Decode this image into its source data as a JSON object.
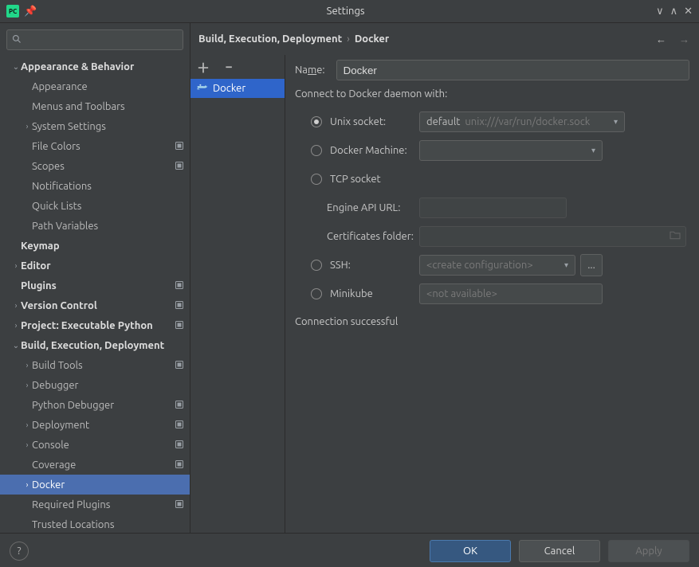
{
  "window_title": "Settings",
  "breadcrumb": {
    "a": "Build, Execution, Deployment",
    "b": "Docker"
  },
  "search_placeholder": "",
  "tree": [
    {
      "label": "Appearance & Behavior",
      "indent": 0,
      "bold": true,
      "arrow": "down",
      "proj": false
    },
    {
      "label": "Appearance",
      "indent": 1,
      "bold": false,
      "arrow": "",
      "proj": false
    },
    {
      "label": "Menus and Toolbars",
      "indent": 1,
      "bold": false,
      "arrow": "",
      "proj": false
    },
    {
      "label": "System Settings",
      "indent": 1,
      "bold": false,
      "arrow": "right",
      "proj": false
    },
    {
      "label": "File Colors",
      "indent": 1,
      "bold": false,
      "arrow": "",
      "proj": true
    },
    {
      "label": "Scopes",
      "indent": 1,
      "bold": false,
      "arrow": "",
      "proj": true
    },
    {
      "label": "Notifications",
      "indent": 1,
      "bold": false,
      "arrow": "",
      "proj": false
    },
    {
      "label": "Quick Lists",
      "indent": 1,
      "bold": false,
      "arrow": "",
      "proj": false
    },
    {
      "label": "Path Variables",
      "indent": 1,
      "bold": false,
      "arrow": "",
      "proj": false
    },
    {
      "label": "Keymap",
      "indent": 0,
      "bold": true,
      "arrow": "",
      "proj": false
    },
    {
      "label": "Editor",
      "indent": 0,
      "bold": true,
      "arrow": "right",
      "proj": false
    },
    {
      "label": "Plugins",
      "indent": 0,
      "bold": true,
      "arrow": "",
      "proj": true
    },
    {
      "label": "Version Control",
      "indent": 0,
      "bold": true,
      "arrow": "right",
      "proj": true
    },
    {
      "label": "Project: Executable Python",
      "indent": 0,
      "bold": true,
      "arrow": "right",
      "proj": true
    },
    {
      "label": "Build, Execution, Deployment",
      "indent": 0,
      "bold": true,
      "arrow": "down",
      "proj": false
    },
    {
      "label": "Build Tools",
      "indent": 1,
      "bold": false,
      "arrow": "right",
      "proj": true
    },
    {
      "label": "Debugger",
      "indent": 1,
      "bold": false,
      "arrow": "right",
      "proj": false
    },
    {
      "label": "Python Debugger",
      "indent": 1,
      "bold": false,
      "arrow": "",
      "proj": true
    },
    {
      "label": "Deployment",
      "indent": 1,
      "bold": false,
      "arrow": "right",
      "proj": true
    },
    {
      "label": "Console",
      "indent": 1,
      "bold": false,
      "arrow": "right",
      "proj": true
    },
    {
      "label": "Coverage",
      "indent": 1,
      "bold": false,
      "arrow": "",
      "proj": true
    },
    {
      "label": "Docker",
      "indent": 1,
      "bold": false,
      "arrow": "right",
      "proj": false,
      "selected": true
    },
    {
      "label": "Required Plugins",
      "indent": 1,
      "bold": false,
      "arrow": "",
      "proj": true
    },
    {
      "label": "Trusted Locations",
      "indent": 1,
      "bold": false,
      "arrow": "",
      "proj": false
    }
  ],
  "mid_list_item": "Docker",
  "form": {
    "name_label_pre": "Na",
    "name_label_u": "m",
    "name_label_post": "e:",
    "name_value": "Docker",
    "connect_title": "Connect to Docker daemon with:",
    "radios": {
      "unix": "Unix socket:",
      "machine": "Docker Machine:",
      "tcp": "TCP socket",
      "ssh": "SSH:",
      "minikube": "Minikube"
    },
    "unix_default": "default",
    "unix_path": "unix:///var/run/docker.sock",
    "engine_url_label": "Engine API URL:",
    "cert_label": "Certificates folder:",
    "ssh_placeholder": "<create configuration>",
    "ssh_more": "...",
    "minikube_value": "<not available>",
    "status": "Connection successful"
  },
  "footer": {
    "ok": "OK",
    "cancel": "Cancel",
    "apply": "Apply"
  }
}
